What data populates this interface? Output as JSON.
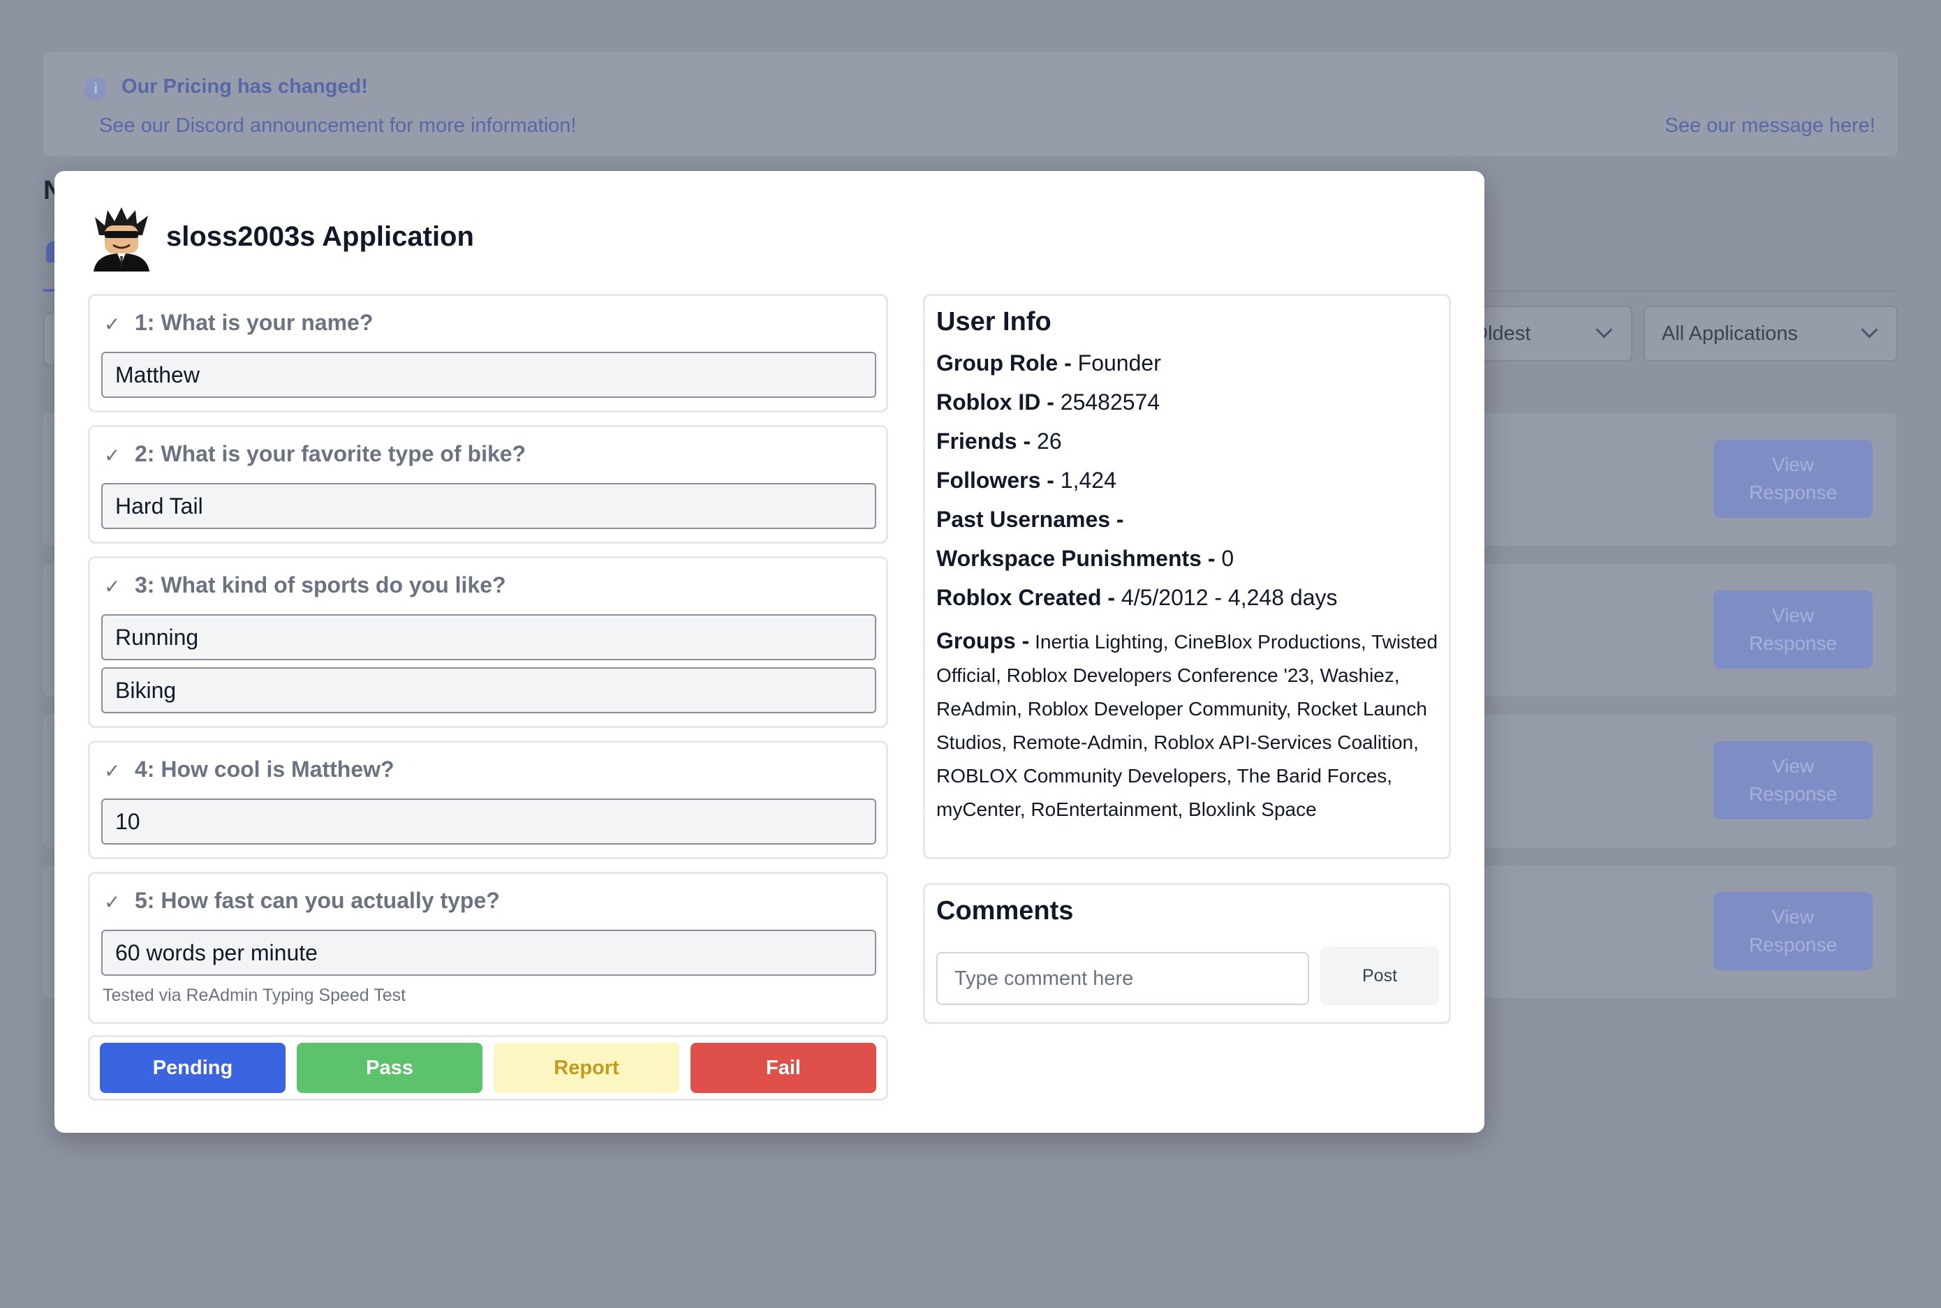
{
  "background": {
    "banner": {
      "title": "Our Pricing has changed!",
      "subtitle": "See our Discord announcement for more information!",
      "link": "See our message here!"
    },
    "heading_initial": "N",
    "sort_select": "↓ Oldest",
    "filter_select": "All Applications",
    "view_button_label": "View Response"
  },
  "modal": {
    "title": "sloss2003s Application",
    "questions": [
      {
        "label": "1: What is your name?",
        "answers": [
          "Matthew"
        ]
      },
      {
        "label": "2: What is your favorite type of bike?",
        "answers": [
          "Hard Tail"
        ]
      },
      {
        "label": "3: What kind of sports do you like?",
        "answers": [
          "Running",
          "Biking"
        ]
      },
      {
        "label": "4: How cool is Matthew?",
        "answers": [
          "10"
        ]
      },
      {
        "label": "5: How fast can you actually type?",
        "answers": [
          "60 words per minute"
        ],
        "note": "Tested via ReAdmin Typing Speed Test"
      }
    ],
    "actions": {
      "pending": "Pending",
      "pass": "Pass",
      "report": "Report",
      "fail": "Fail"
    },
    "user_info": {
      "title": "User Info",
      "group_role_label": "Group Role -",
      "group_role": "Founder",
      "roblox_id_label": "Roblox ID -",
      "roblox_id": "25482574",
      "friends_label": "Friends -",
      "friends": "26",
      "followers_label": "Followers -",
      "followers": "1,424",
      "past_usernames_label": "Past Usernames -",
      "punishments_label": "Workspace Punishments -",
      "punishments": "0",
      "created_label": "Roblox Created -",
      "created": "4/5/2012 - 4,248 days",
      "groups_label": "Groups -",
      "groups": "Inertia Lighting, CineBlox Productions, Twisted Official, Roblox Developers Conference '23, Washiez, ReAdmin, Roblox Developer Community, Rocket Launch Studios, Remote-Admin, Roblox API-Services Coalition, ROBLOX Community Developers, The Barid Forces, myCenter, RoEntertainment, Bloxlink Space"
    },
    "comments": {
      "title": "Comments",
      "placeholder": "Type comment here",
      "post_label": "Post"
    }
  }
}
